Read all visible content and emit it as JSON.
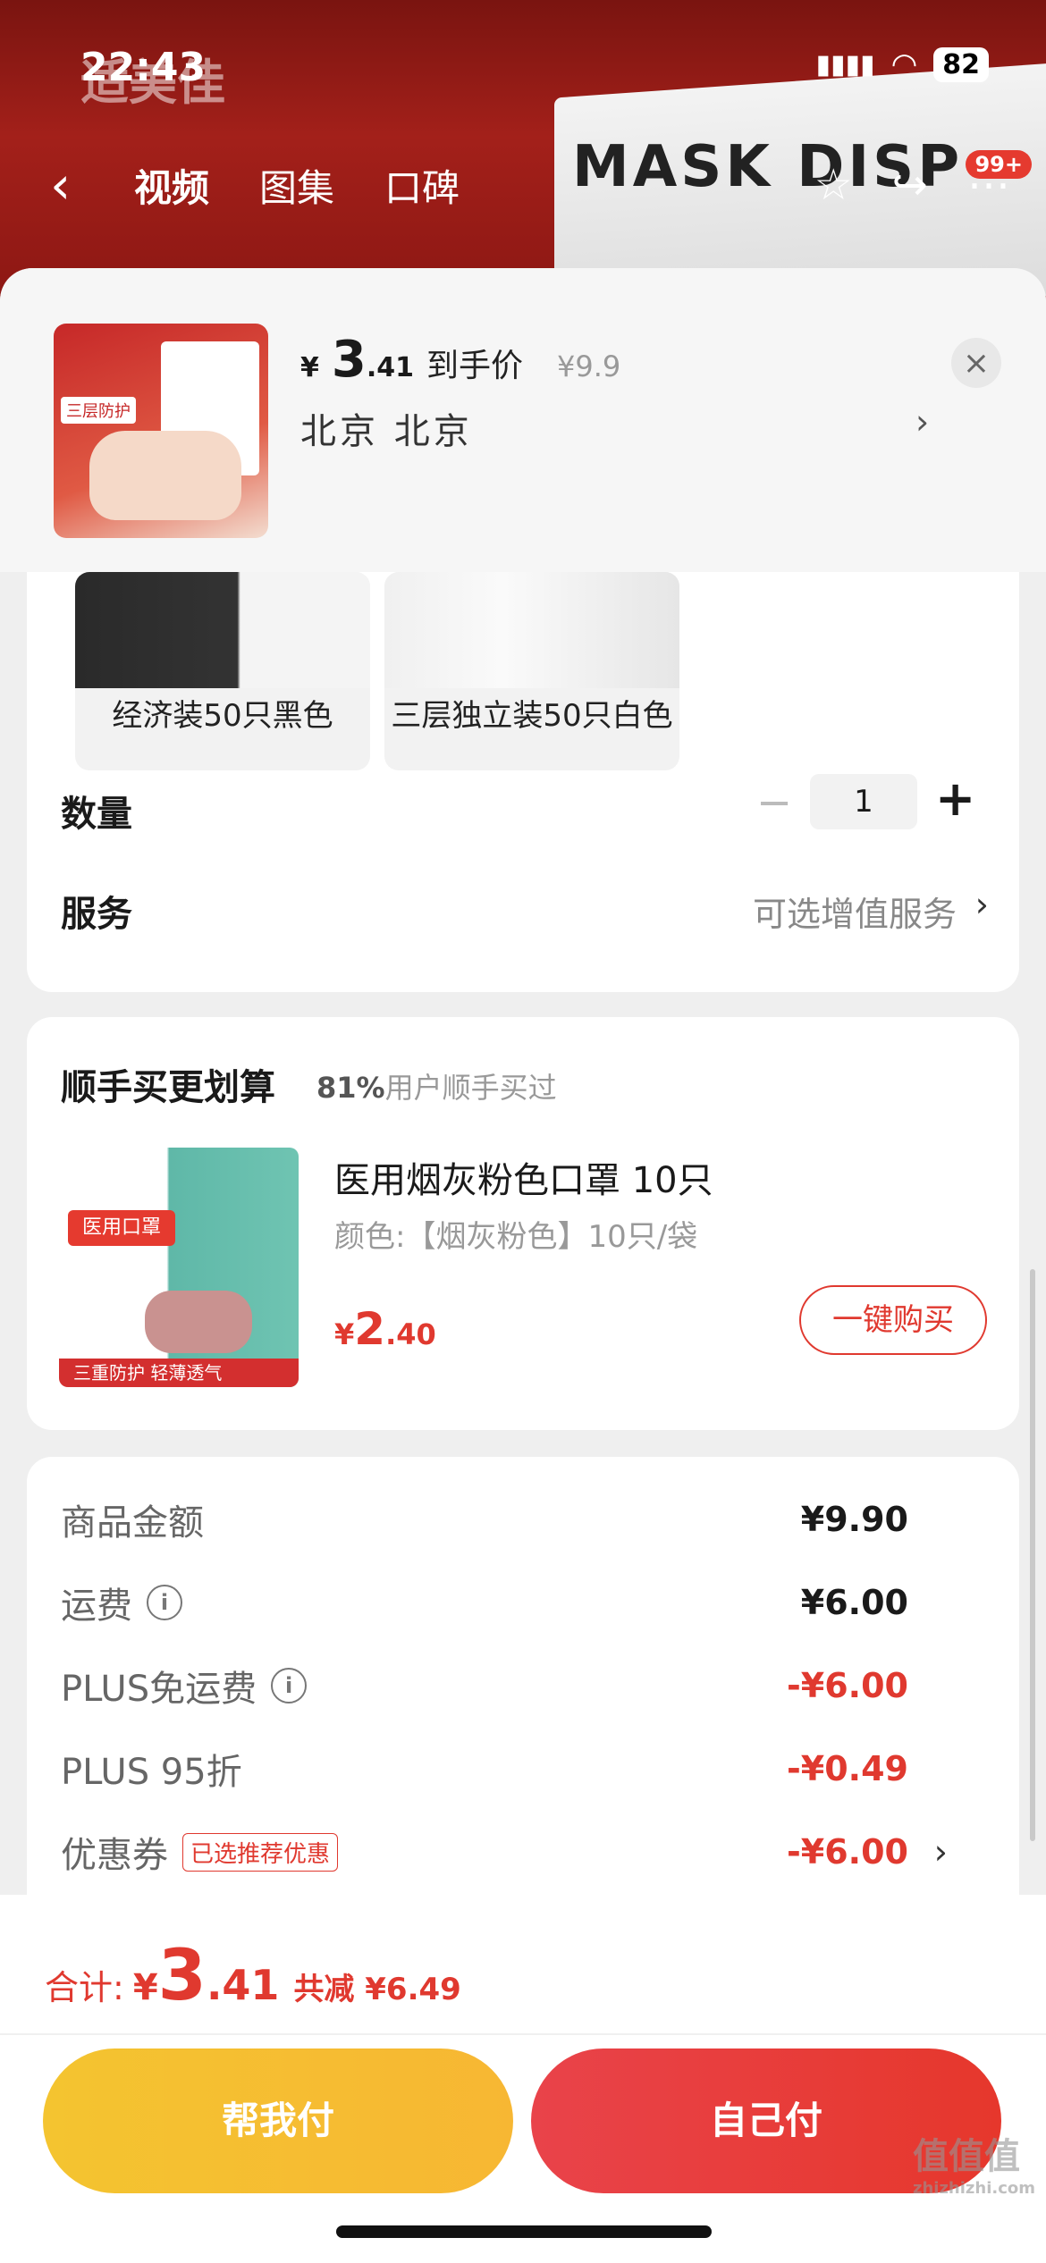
{
  "status_bar": {
    "time": "22:43",
    "battery": "82"
  },
  "hero": {
    "brand": "适美佳",
    "box_text": "MASK DISP"
  },
  "nav": {
    "tabs": [
      "视频",
      "图集",
      "口碑"
    ],
    "badge": "99+"
  },
  "product": {
    "currency": "¥",
    "price_int": "3",
    "price_dec": ".41",
    "price_tag": "到手价",
    "original_price": "¥9.9",
    "location": "北京  北京",
    "thumb_text": "三层防护"
  },
  "variants": [
    {
      "label": "经济装50只黑色"
    },
    {
      "label": "三层独立装50只白色"
    }
  ],
  "quantity": {
    "label": "数量",
    "value": "1",
    "minus": "−",
    "plus": "+"
  },
  "service": {
    "label": "服务",
    "value": "可选增值服务"
  },
  "recommend": {
    "title": "顺手买更划算",
    "percent": "81%",
    "sub": "用户顺手买过",
    "name": "医用烟灰粉色口罩 10只",
    "spec": "颜色:【烟灰粉色】10只/袋",
    "currency": "¥",
    "price_int": "2",
    "price_dec": ".40",
    "buy_label": "一键购买",
    "img_tag": "医用口罩",
    "img_bottom": "三重防护 轻薄透气"
  },
  "fees": [
    {
      "label": "商品金额",
      "value": "¥9.90",
      "red": false
    },
    {
      "label": "运费",
      "value": "¥6.00",
      "red": false,
      "info": true
    },
    {
      "label": "PLUS免运费",
      "value": "-¥6.00",
      "red": true,
      "info": true
    },
    {
      "label": "PLUS 95折",
      "value": "-¥0.49",
      "red": true
    },
    {
      "label": "优惠券",
      "value": "-¥6.00",
      "red": true,
      "tag": "已选推荐优惠"
    }
  ],
  "footer": {
    "total_label": "合计:",
    "currency": "¥",
    "total_int": "3",
    "total_dec": ".41",
    "saved": "共减 ¥6.49",
    "help_pay": "帮我付",
    "self_pay": "自己付"
  },
  "watermark": {
    "main": "值值值",
    "sub": "zhizhizhi.com"
  },
  "colors": {
    "accent_red": "#e0392f",
    "help_yellow": "#f4c430",
    "self_red": "#e6372c"
  }
}
